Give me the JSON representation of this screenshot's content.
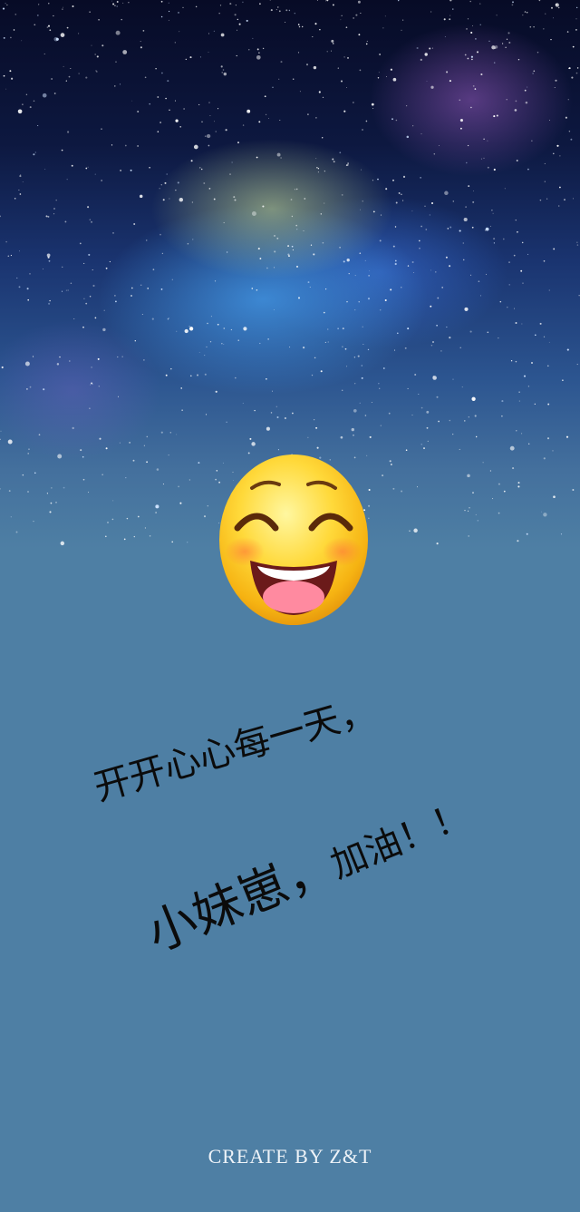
{
  "greeting": {
    "line1": "开开心心每一天，",
    "line2_main": "小妹崽，",
    "line2_tail": "加油！！"
  },
  "footer": {
    "credit": "CREATE BY Z&T"
  },
  "icons": {
    "emoji": "grinning-face-with-smiling-eyes-icon"
  },
  "colors": {
    "background": "#4e7fa4",
    "sky_top": "#070b26",
    "text": "#0b0b0b",
    "credit": "#eef3f8"
  }
}
